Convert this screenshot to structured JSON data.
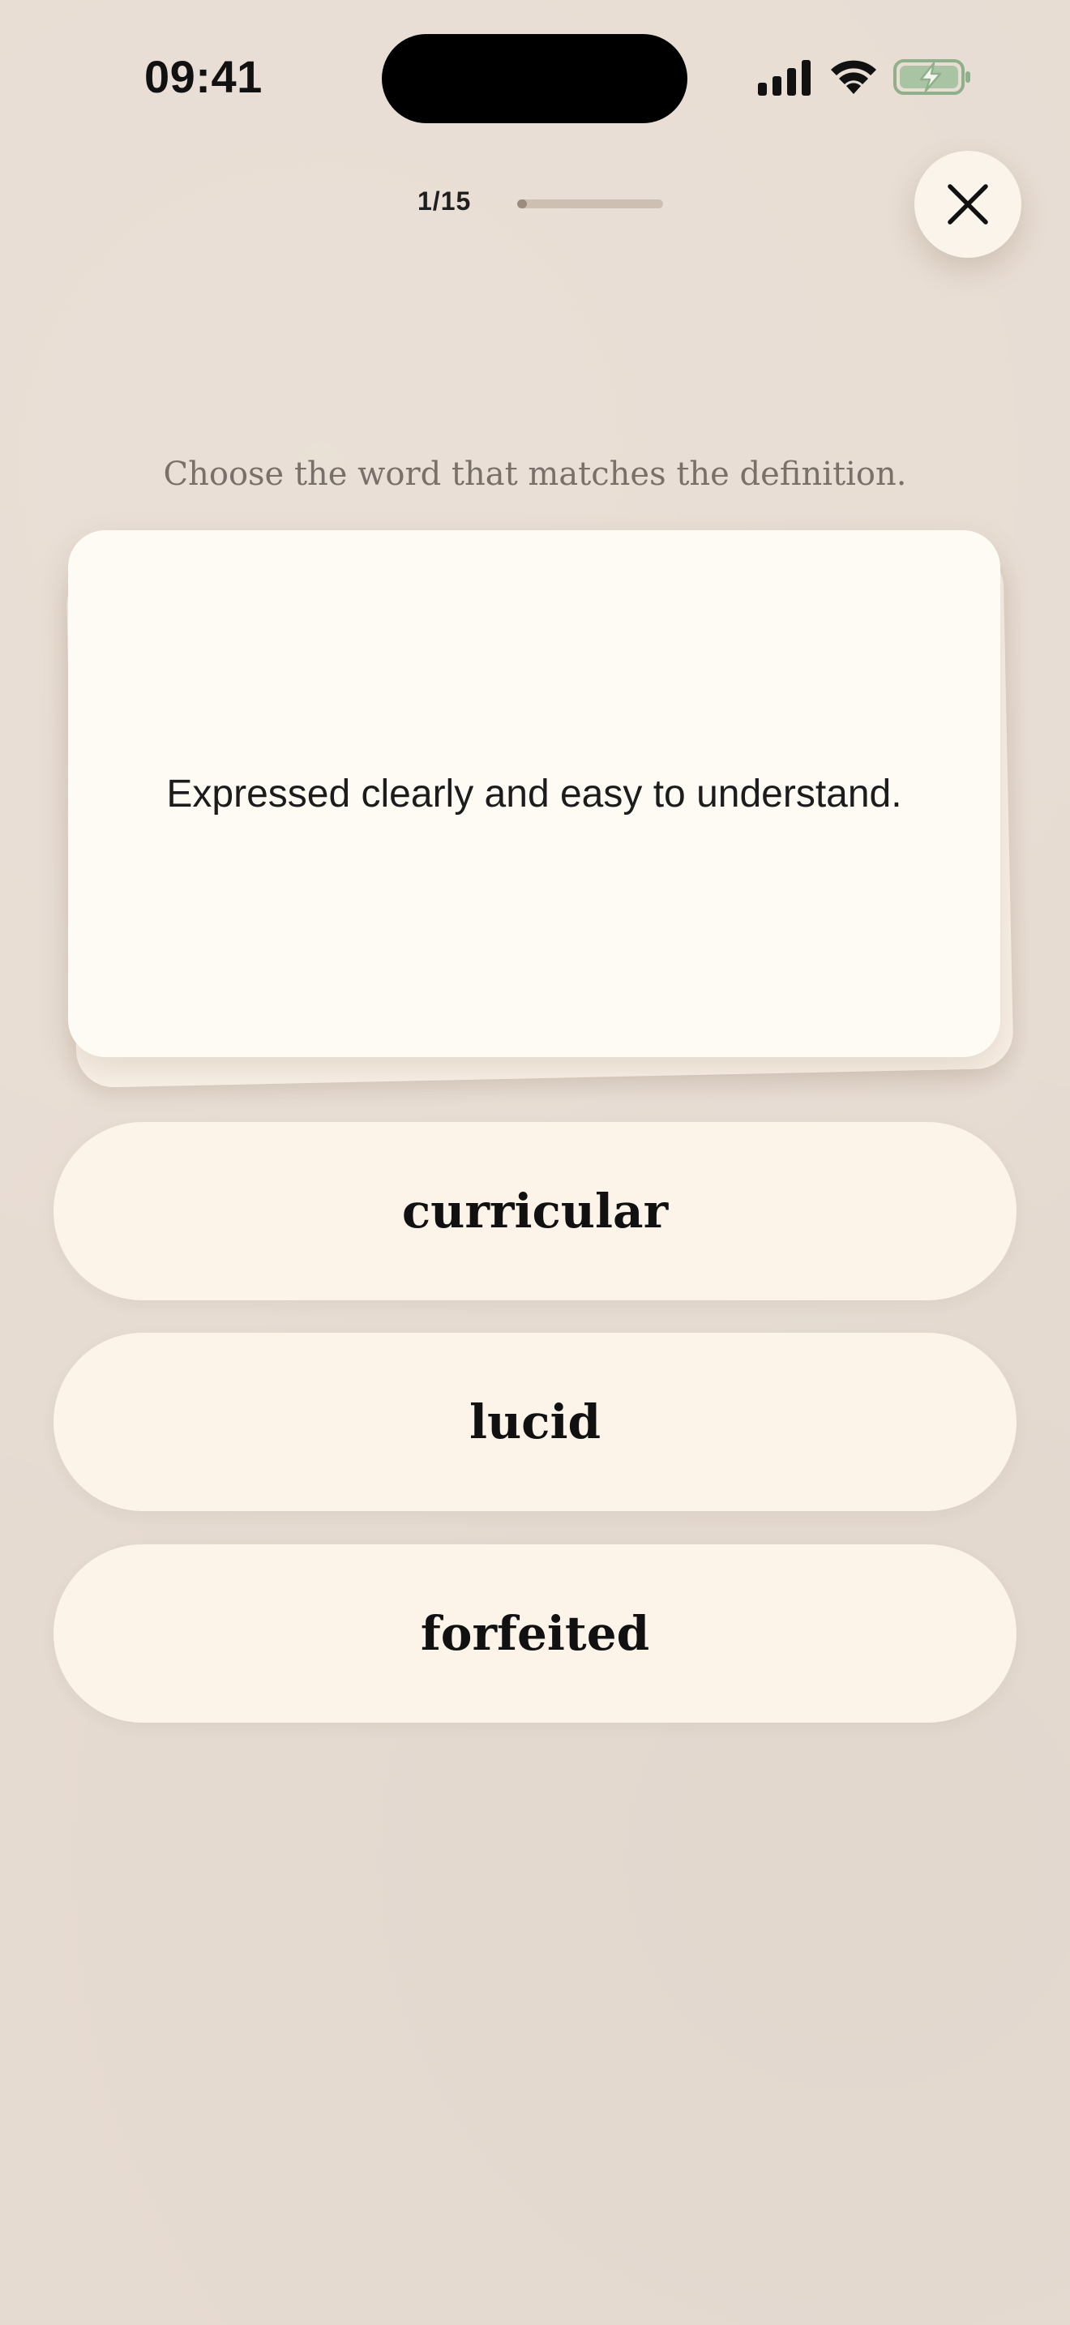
{
  "status_bar": {
    "time": "09:41",
    "icons": [
      "signal-icon",
      "wifi-icon",
      "battery-charging-icon"
    ],
    "battery_color": "#8fb08a"
  },
  "progress": {
    "label": "1/15",
    "current": 1,
    "total": 15,
    "fraction": 0.0667
  },
  "close_icon": "close-icon",
  "instruction": "Choose the word that matches the definition.",
  "card": {
    "definition": "Expressed clearly and easy to understand."
  },
  "options": [
    {
      "label": "curricular"
    },
    {
      "label": "lucid"
    },
    {
      "label": "forfeited"
    }
  ],
  "colors": {
    "background": "#e7dcd2",
    "card": "#fefbf5",
    "option": "#fcf3e9"
  }
}
